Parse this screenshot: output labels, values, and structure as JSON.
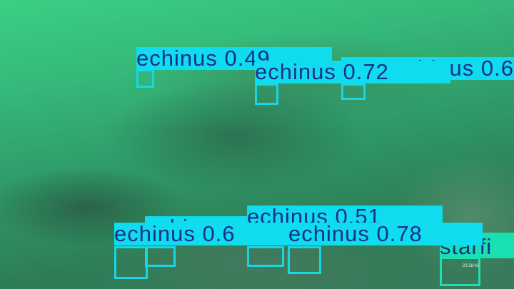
{
  "detections": [
    {
      "label": "echinus 0.6",
      "color": "#0fdcec"
    },
    {
      "label": "echinus 0.49",
      "color": "#0fdcec"
    },
    {
      "label": "echinus 0.72",
      "color": "#0fdcec"
    },
    {
      "label": "echinus",
      "color": "#0fdcec"
    },
    {
      "label": "echinus 0.51",
      "color": "#0fdcec"
    },
    {
      "label": "echinus 0.6",
      "color": "#0fdcec"
    },
    {
      "label": "echinus 0.78",
      "color": "#0fdcec"
    },
    {
      "label": "starfi",
      "color": "#18e0b0"
    }
  ],
  "timestamp": "22:58:42"
}
